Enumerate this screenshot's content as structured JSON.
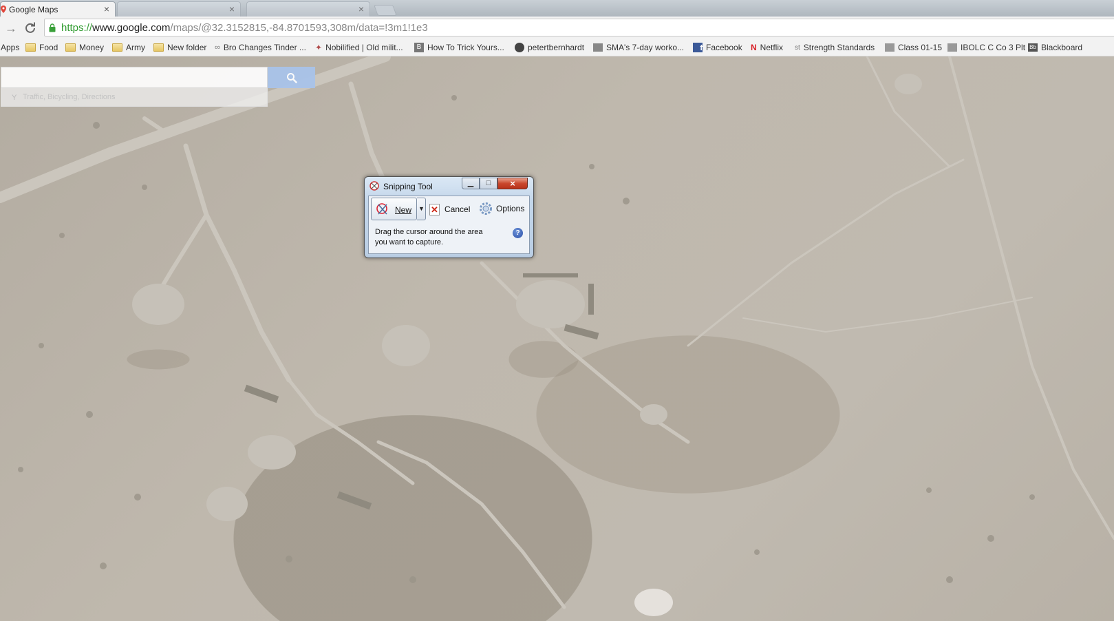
{
  "browser": {
    "tabs": [
      {
        "title": "Google Maps",
        "active": true
      },
      {
        "title": "",
        "active": false
      },
      {
        "title": "",
        "active": false
      }
    ],
    "url": {
      "scheme": "https://",
      "host": "www.google.com",
      "path": "/maps/@32.3152815,-84.8701593,308m/data=!3m1!1e3"
    }
  },
  "bookmarks": [
    {
      "label": "Apps",
      "icon": "apps-grid-icon"
    },
    {
      "label": "Food",
      "icon": "folder-icon"
    },
    {
      "label": "Money",
      "icon": "folder-icon"
    },
    {
      "label": "Army",
      "icon": "folder-icon"
    },
    {
      "label": "New folder",
      "icon": "folder-icon"
    },
    {
      "label": "Bro Changes Tinder ...",
      "icon": "site-icon"
    },
    {
      "label": "Nobilified | Old milit...",
      "icon": "site-icon"
    },
    {
      "label": "How To Trick Yours...",
      "icon": "site-icon"
    },
    {
      "label": "petertbernhardt",
      "icon": "github-icon"
    },
    {
      "label": "SMA's 7-day worko...",
      "icon": "site-icon"
    },
    {
      "label": "Facebook",
      "icon": "facebook-icon"
    },
    {
      "label": "Netflix",
      "icon": "netflix-icon"
    },
    {
      "label": "Strength Standards",
      "icon": "site-icon"
    },
    {
      "label": "Class 01-15",
      "icon": "site-icon"
    },
    {
      "label": "IBOLC C Co 3 Plt",
      "icon": "site-icon"
    },
    {
      "label": "Blackboard",
      "icon": "site-icon"
    }
  ],
  "maps": {
    "search_value": "",
    "sub_link": "Traffic, Bicycling, Directions"
  },
  "snipping_tool": {
    "title": "Snipping Tool",
    "new_label": "New",
    "cancel_label": "Cancel",
    "options_label": "Options",
    "message": "Drag the cursor around the area you want to capture.",
    "help_glyph": "?"
  },
  "colors": {
    "url_scheme": "#2f9b2f",
    "search_button": "#a9c3ea",
    "close_button": "#c9472c"
  }
}
